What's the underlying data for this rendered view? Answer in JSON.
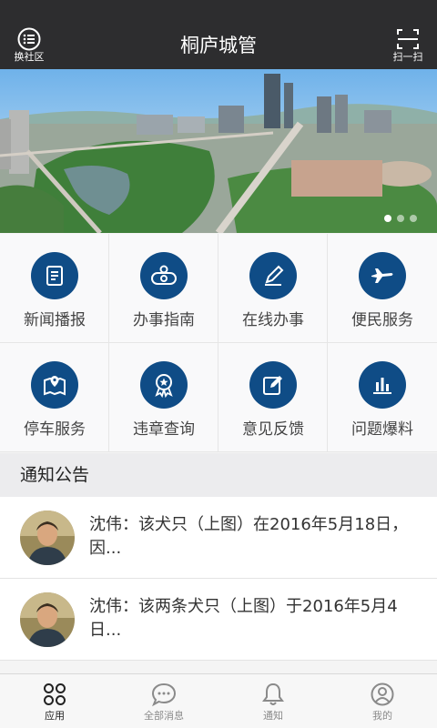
{
  "header": {
    "title": "桐庐城管",
    "left_label": "换社区",
    "right_label": "扫一扫"
  },
  "banner": {
    "slide_count": 3,
    "active_index": 0
  },
  "services": [
    {
      "label": "新闻播报",
      "icon": "news-icon"
    },
    {
      "label": "办事指南",
      "icon": "guide-icon"
    },
    {
      "label": "在线办事",
      "icon": "pen-icon"
    },
    {
      "label": "便民服务",
      "icon": "airplane-icon"
    },
    {
      "label": "停车服务",
      "icon": "map-pin-icon"
    },
    {
      "label": "违章查询",
      "icon": "badge-icon"
    },
    {
      "label": "意见反馈",
      "icon": "edit-icon"
    },
    {
      "label": "问题爆料",
      "icon": "bar-chart-icon"
    }
  ],
  "notice": {
    "title": "通知公告",
    "items": [
      {
        "text": "沈伟：该犬只（上图）在2016年5月18日，因..."
      },
      {
        "text": "沈伟：该两条犬只（上图）于2016年5月4日..."
      }
    ]
  },
  "tabs": [
    {
      "label": "应用",
      "icon": "apps-icon",
      "active": true
    },
    {
      "label": "全部消息",
      "icon": "chat-icon",
      "active": false
    },
    {
      "label": "通知",
      "icon": "bell-icon",
      "active": false
    },
    {
      "label": "我的",
      "icon": "user-icon",
      "active": false
    }
  ],
  "colors": {
    "header_bg": "#2d2d2f",
    "icon_circle": "#0f4c86"
  }
}
